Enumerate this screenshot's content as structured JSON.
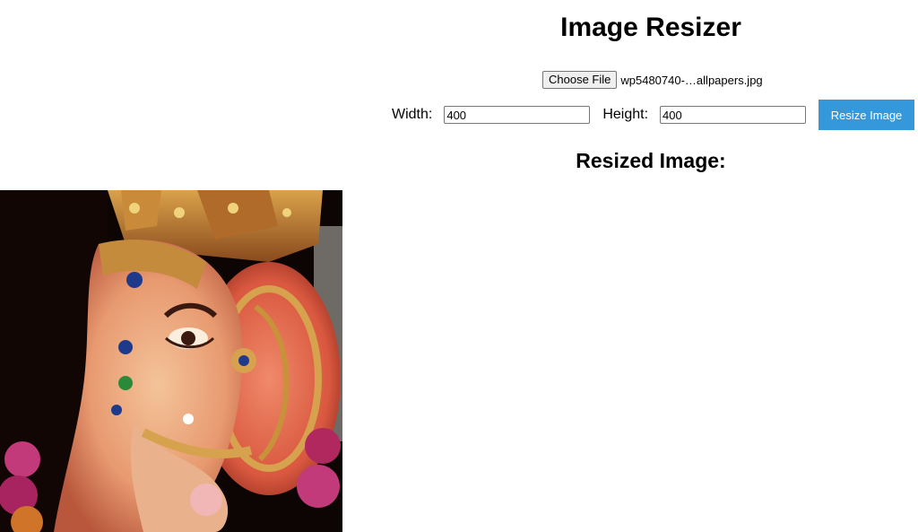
{
  "page": {
    "title": "Image Resizer",
    "result_heading": "Resized Image:"
  },
  "file_picker": {
    "button_label": "Choose File",
    "file_name": "wp5480740-…allpapers.jpg"
  },
  "dimensions": {
    "width_label": "Width:",
    "width_value": "400",
    "height_label": "Height:",
    "height_value": "400"
  },
  "actions": {
    "resize_label": "Resize Image",
    "resize_color": "#3498db"
  },
  "preview": {
    "subject": "ganesha-idol-photo"
  }
}
